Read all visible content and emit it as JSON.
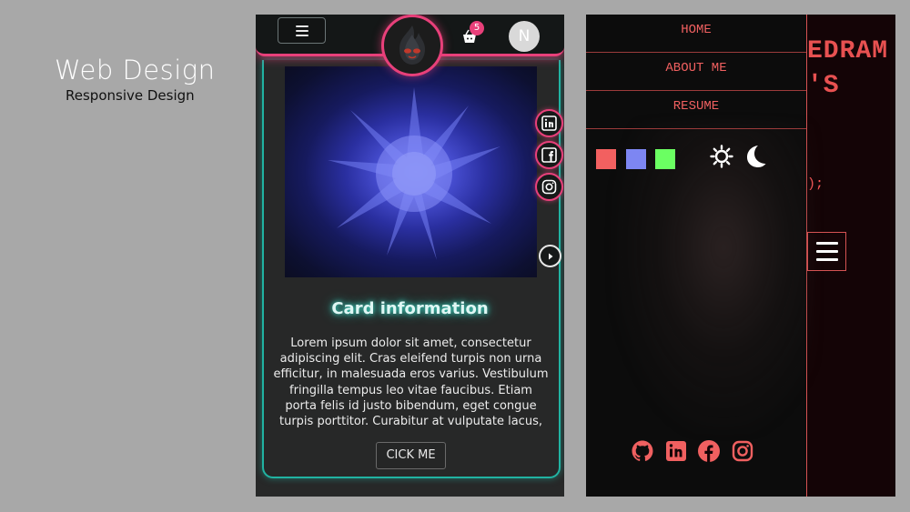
{
  "caption": {
    "title": "Web Design",
    "subtitle": "Responsive Design"
  },
  "phone1": {
    "header": {
      "menu_icon": "hamburger-icon",
      "logo_icon": "fire-skull-logo",
      "cart_icon": "basket-icon",
      "cart_count": "5",
      "user_initial": "N"
    },
    "card": {
      "title": "Card information",
      "body": "Lorem ipsum dolor sit amet, consectetur adipiscing elit. Cras eleifend turpis non urna efficitur, in malesuada eros varius. Vestibulum fringilla tempus leo vitae faucibus. Etiam porta felis id justo bibendum, eget congue turpis porttitor. Curabitur at vulputate lacus,",
      "button": "CICK ME"
    },
    "social": [
      "linkedin-icon",
      "facebook-icon",
      "instagram-icon"
    ],
    "next_icon": "chevron-right-icon",
    "colors": {
      "header_border": "#e8407a",
      "card_border": "#21b3a2"
    }
  },
  "phone2": {
    "nav": [
      "HOME",
      "ABOUT ME",
      "RESUME"
    ],
    "bg_title_line1": "EDRAM",
    "bg_title_line2": "'S",
    "bg_code": ");",
    "swatches": [
      "#f26060",
      "#7d86f2",
      "#6bff62"
    ],
    "theme_icons": [
      "sun-icon",
      "moon-icon"
    ],
    "menu_icon": "hamburger-icon",
    "social": [
      "github-icon",
      "linkedin-icon",
      "facebook-icon",
      "instagram-icon"
    ],
    "accent": "#f06060"
  }
}
